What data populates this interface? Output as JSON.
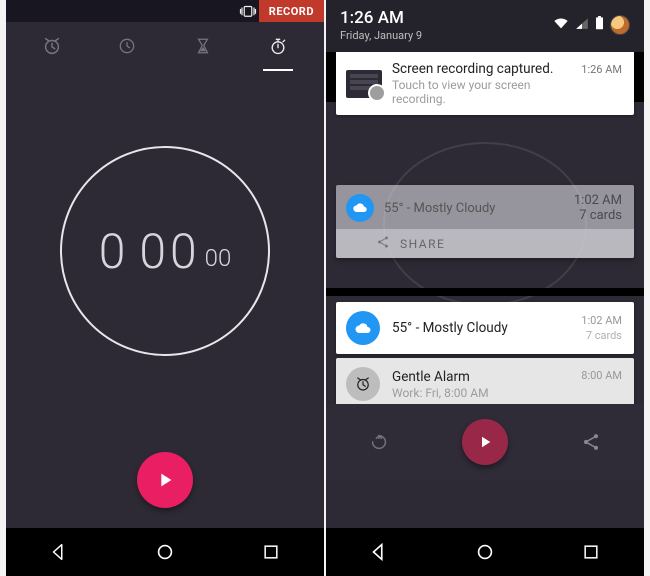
{
  "left_phone": {
    "topbar": {
      "record_label": "RECORD"
    },
    "tabs": [
      "alarm",
      "clock",
      "timer",
      "stopwatch"
    ],
    "active_tab": "stopwatch",
    "stopwatch": {
      "minutes": "0",
      "seconds": "00",
      "centis": "00"
    }
  },
  "right_phone": {
    "status": {
      "time": "1:26 AM",
      "date": "Friday, January 9"
    },
    "notifications": {
      "screen_rec": {
        "title": "Screen recording captured.",
        "sub": "Touch to view your screen recording.",
        "time": "1:26 AM"
      },
      "weather_card": {
        "title": "55° - Mostly Cloudy",
        "time": "1:02 AM",
        "cards": "7 cards",
        "share_label": "SHARE"
      },
      "weather_notif": {
        "title": "55° - Mostly Cloudy",
        "time": "1:02 AM",
        "cards": "7 cards"
      },
      "alarm_notif": {
        "title": "Gentle Alarm",
        "sub": "Work: Fri, 8:00 AM",
        "time": "8:00 AM"
      }
    }
  }
}
